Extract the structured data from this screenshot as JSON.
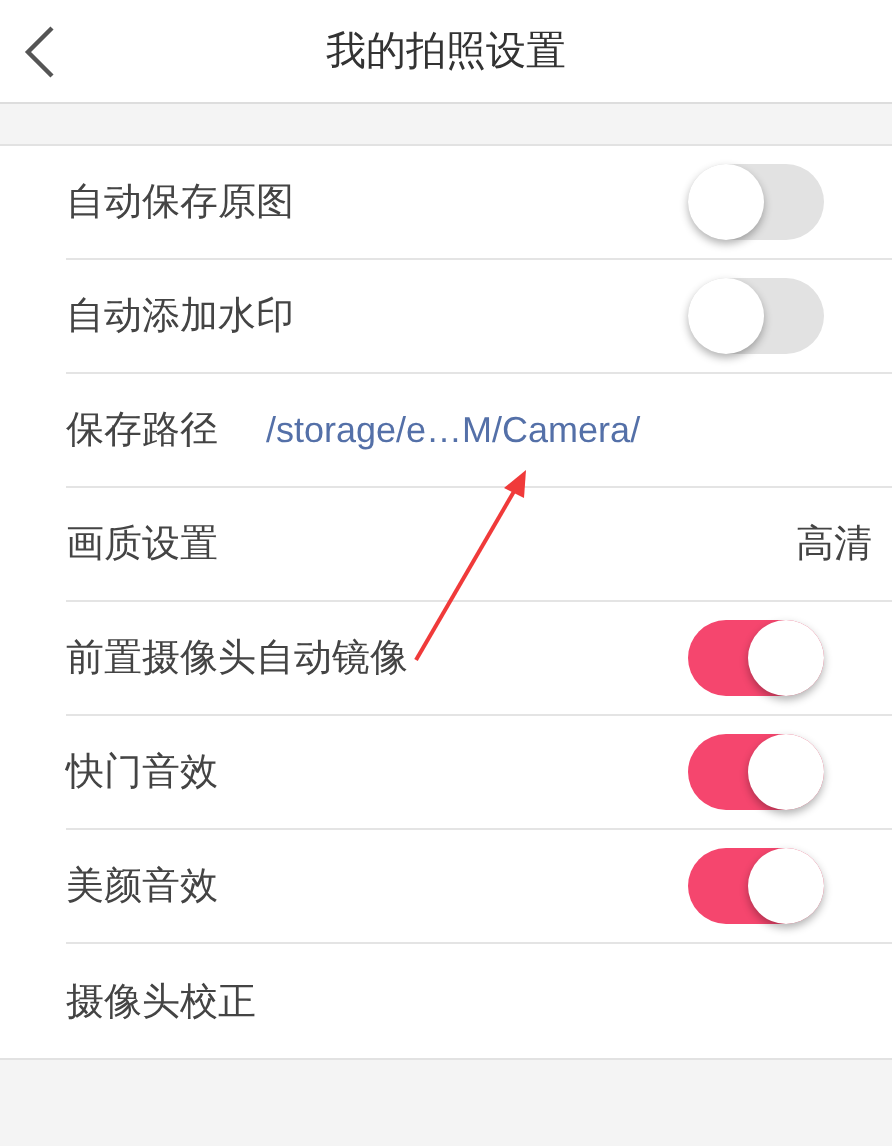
{
  "header": {
    "title": "我的拍照设置"
  },
  "rows": [
    {
      "kind": "toggle",
      "label": "自动保存原图",
      "on": false
    },
    {
      "kind": "toggle",
      "label": "自动添加水印",
      "on": false
    },
    {
      "kind": "path",
      "label": "保存路径",
      "value": "/storage/e…M/Camera/"
    },
    {
      "kind": "value",
      "label": "画质设置",
      "value": "高清"
    },
    {
      "kind": "toggle",
      "label": "前置摄像头自动镜像",
      "on": true
    },
    {
      "kind": "toggle",
      "label": "快门音效",
      "on": true
    },
    {
      "kind": "toggle",
      "label": "美颜音效",
      "on": true
    },
    {
      "kind": "plain",
      "label": "摄像头校正"
    }
  ]
}
